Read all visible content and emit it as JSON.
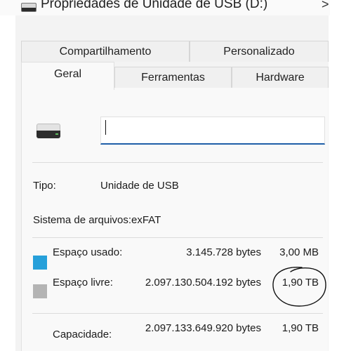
{
  "window": {
    "title": "Propriedades de Unidade de USB (D:)",
    "close_glyph": ">"
  },
  "tabs": {
    "row_back": [
      "Compartilhamento",
      "Personalizado"
    ],
    "row_front": [
      "Geral",
      "Ferramentas",
      "Hardware"
    ],
    "active": "Geral"
  },
  "general": {
    "drive_name_value": "",
    "type_label": "Tipo:",
    "type_value": "Unidade de USB",
    "filesystem_label": "Sistema de arquivos:",
    "filesystem_value": "exFAT",
    "used": {
      "label": "Espaço usado:",
      "bytes": "3.145.728 bytes",
      "size": "3,00 MB",
      "color": "#26a0da"
    },
    "free": {
      "label": "Espaço livre:",
      "bytes": "2.097.130.504.192 bytes",
      "size": "1,90 TB",
      "color": "#b4b4b4"
    },
    "capacity": {
      "label": "Capacidade:",
      "bytes": "2.097.133.649.920 bytes",
      "size": "1,90 TB"
    }
  }
}
